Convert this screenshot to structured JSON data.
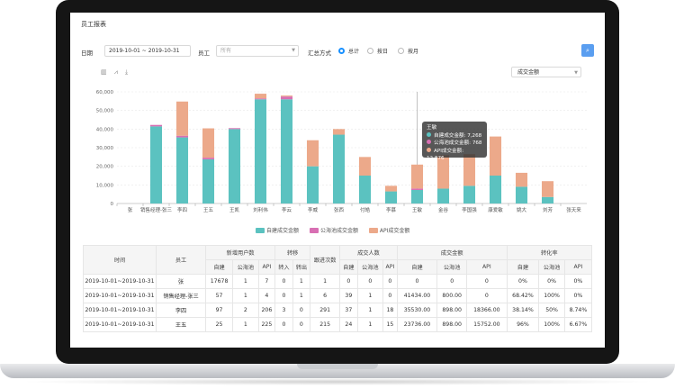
{
  "page_title": "员工报表",
  "filters": {
    "date_label": "日期",
    "date_value": "2019-10-01 ~ 2019-10-31",
    "employee_label": "员工",
    "employee_placeholder": "所有",
    "mode_label": "汇总方式",
    "modes": [
      "总计",
      "按日",
      "按月"
    ],
    "selected_mode": "总计"
  },
  "metric_select": "成交金额",
  "chart_data": {
    "type": "bar",
    "stacked": true,
    "categories": [
      "张",
      "销售经理-张三",
      "李四",
      "王五",
      "王凯",
      "刘利伟",
      "李云",
      "李威",
      "张西",
      "付皓",
      "李慕",
      "王敏",
      "金谷",
      "李国强",
      "康爱敏",
      "姚大",
      "刘芳",
      "张天来"
    ],
    "series": [
      {
        "name": "自建成交金额",
        "color": "#5bc2c0",
        "values": [
          0,
          41434,
          35530,
          23736,
          40000,
          56000,
          56000,
          20000,
          37000,
          15000,
          6500,
          7268,
          8000,
          9500,
          15000,
          9000,
          3500,
          0
        ]
      },
      {
        "name": "公海池成交金额",
        "color": "#d86fb3",
        "values": [
          0,
          800,
          898,
          898,
          500,
          500,
          1500,
          0,
          0,
          0,
          0,
          768,
          0,
          0,
          0,
          0,
          0,
          0
        ]
      },
      {
        "name": "API成交金额",
        "color": "#eca98a",
        "values": [
          0,
          0,
          18366,
          15752,
          0,
          2500,
          500,
          14000,
          3000,
          10000,
          3000,
          12876,
          18000,
          17000,
          21000,
          7500,
          8500,
          0
        ]
      }
    ],
    "ylim": [
      0,
      60000
    ],
    "yticks": [
      "0",
      "10,000",
      "20,000",
      "30,000",
      "40,000",
      "50,000",
      "60,000"
    ],
    "grid": true,
    "legend_position": "bottom",
    "tooltip": {
      "title": "王敏",
      "lines": [
        "自建成交金额: 7,268",
        "公海池成交金额: 768",
        "API成交金额: 12,876"
      ]
    }
  },
  "table": {
    "headers_top": [
      "时间",
      "员工",
      "新增用户数",
      "转移",
      "跟进次数",
      "成交人数",
      "成交金额",
      "转化率"
    ],
    "headers_sub": [
      "自建",
      "公海池",
      "API",
      "转入",
      "转出",
      "自建",
      "公海池",
      "API",
      "自建",
      "公海池",
      "API",
      "自建",
      "公海池",
      "API"
    ],
    "rows": [
      [
        "2019-10-01~2019-10-31",
        "张",
        "17678",
        "1",
        "7",
        "0",
        "1",
        "1",
        "0",
        "0",
        "0",
        "0",
        "0",
        "0",
        "0%",
        "0%",
        "0%"
      ],
      [
        "2019-10-01~2019-10-31",
        "销售经理-张三",
        "57",
        "1",
        "4",
        "0",
        "1",
        "6",
        "39",
        "1",
        "0",
        "41434.00",
        "800.00",
        "0",
        "68.42%",
        "100%",
        "0%"
      ],
      [
        "2019-10-01~2019-10-31",
        "李四",
        "97",
        "2",
        "206",
        "3",
        "0",
        "291",
        "37",
        "1",
        "18",
        "35530.00",
        "898.00",
        "18366.00",
        "38.14%",
        "50%",
        "8.74%"
      ],
      [
        "2019-10-01~2019-10-31",
        "王五",
        "25",
        "1",
        "225",
        "0",
        "0",
        "215",
        "24",
        "1",
        "15",
        "23736.00",
        "898.00",
        "15752.00",
        "96%",
        "100%",
        "6.67%"
      ]
    ]
  }
}
